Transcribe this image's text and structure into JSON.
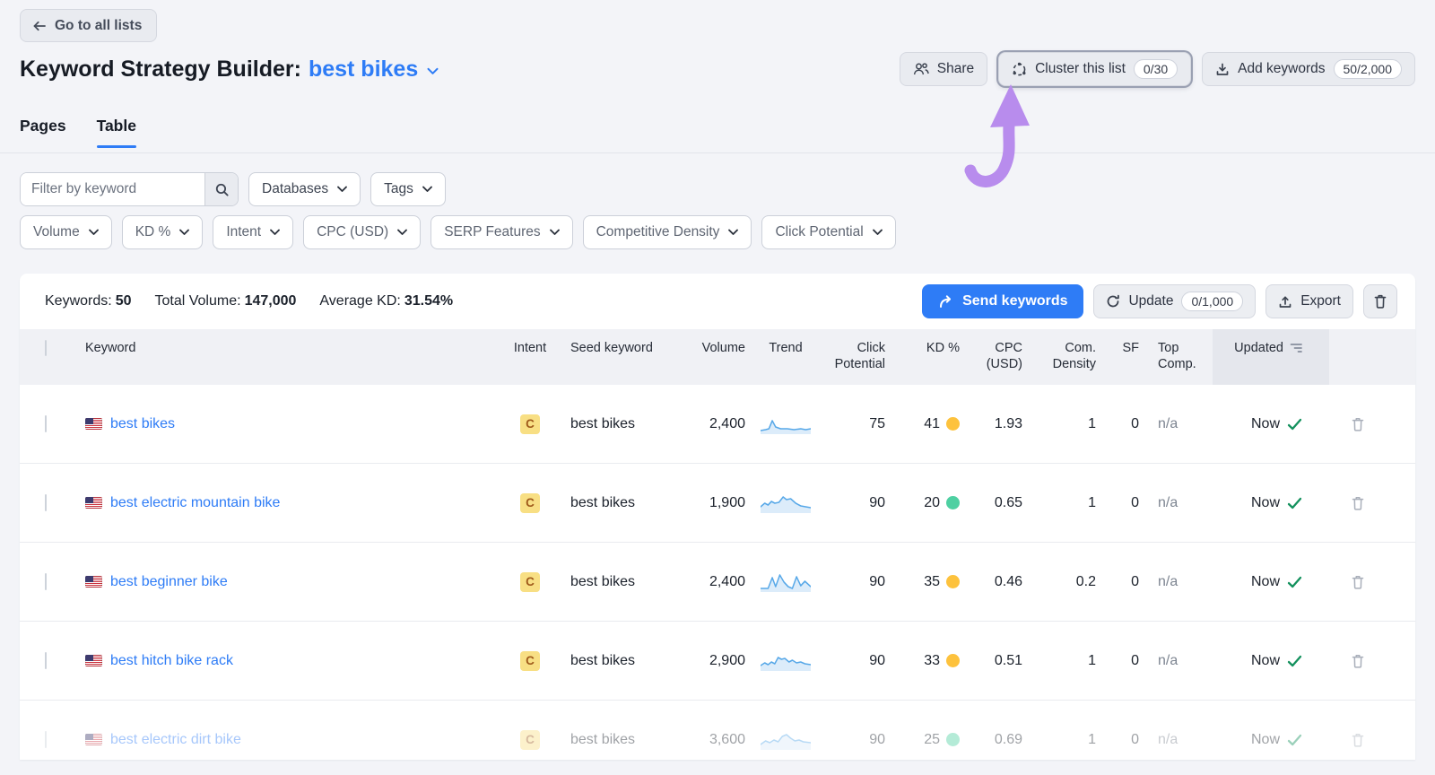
{
  "back_button": {
    "label": "Go to all lists"
  },
  "header": {
    "title": "Keyword Strategy Builder:",
    "list_name": "best bikes",
    "actions": {
      "share_label": "Share",
      "cluster_label": "Cluster this list",
      "cluster_badge": "0/30",
      "add_keywords_label": "Add keywords",
      "add_keywords_badge": "50/2,000"
    }
  },
  "tabs": {
    "pages": "Pages",
    "table": "Table"
  },
  "filters": {
    "keyword_placeholder": "Filter by keyword",
    "databases": "Databases",
    "tags": "Tags",
    "pills": [
      "Volume",
      "KD %",
      "Intent",
      "CPC (USD)",
      "SERP Features",
      "Competitive Density",
      "Click Potential"
    ]
  },
  "toolbar": {
    "keywords_label": "Keywords:",
    "keywords_value": "50",
    "total_volume_label": "Total Volume:",
    "total_volume_value": "147,000",
    "average_kd_label": "Average KD:",
    "average_kd_value": "31.54%",
    "send_label": "Send keywords",
    "update_label": "Update",
    "update_badge": "0/1,000",
    "export_label": "Export"
  },
  "table": {
    "header": {
      "keyword": "Keyword",
      "intent": "Intent",
      "seed": "Seed keyword",
      "volume": "Volume",
      "trend": "Trend",
      "click_potential": "Click Potential",
      "kd": "KD %",
      "cpc": "CPC (USD)",
      "com_density": "Com. Density",
      "sf": "SF",
      "top_comp": "Top Comp.",
      "updated": "Updated"
    },
    "rows": [
      {
        "country": "us",
        "keyword": "best bikes",
        "intent": "C",
        "seed": "best bikes",
        "volume": "2,400",
        "click_potential": "75",
        "kd": "41",
        "kd_level": "orange",
        "cpc": "1.93",
        "com_density": "1",
        "sf": "0",
        "top_comp": "n/a",
        "updated": "Now",
        "trend": [
          [
            0,
            19
          ],
          [
            6,
            18
          ],
          [
            10,
            17
          ],
          [
            14,
            8
          ],
          [
            18,
            15
          ],
          [
            24,
            17
          ],
          [
            32,
            17
          ],
          [
            40,
            18
          ],
          [
            48,
            17
          ],
          [
            54,
            18
          ],
          [
            60,
            17
          ]
        ]
      },
      {
        "country": "us",
        "keyword": "best electric mountain bike",
        "intent": "C",
        "seed": "best bikes",
        "volume": "1,900",
        "click_potential": "90",
        "kd": "20",
        "kd_level": "green",
        "cpc": "0.65",
        "com_density": "1",
        "sf": "0",
        "top_comp": "n/a",
        "updated": "Now",
        "trend": [
          [
            0,
            16
          ],
          [
            5,
            12
          ],
          [
            9,
            14
          ],
          [
            13,
            10
          ],
          [
            17,
            12
          ],
          [
            22,
            11
          ],
          [
            27,
            5
          ],
          [
            31,
            8
          ],
          [
            36,
            7
          ],
          [
            42,
            12
          ],
          [
            48,
            15
          ],
          [
            54,
            16
          ],
          [
            60,
            17
          ]
        ]
      },
      {
        "country": "us",
        "keyword": "best beginner bike",
        "intent": "C",
        "seed": "best bikes",
        "volume": "2,400",
        "click_potential": "90",
        "kd": "35",
        "kd_level": "orange",
        "cpc": "0.46",
        "com_density": "0.2",
        "sf": "0",
        "top_comp": "n/a",
        "updated": "Now",
        "trend": [
          [
            0,
            19
          ],
          [
            9,
            19
          ],
          [
            14,
            7
          ],
          [
            18,
            17
          ],
          [
            23,
            4
          ],
          [
            28,
            12
          ],
          [
            33,
            17
          ],
          [
            38,
            19
          ],
          [
            43,
            6
          ],
          [
            48,
            16
          ],
          [
            53,
            11
          ],
          [
            60,
            17
          ]
        ]
      },
      {
        "country": "us",
        "keyword": "best hitch bike rack",
        "intent": "C",
        "seed": "best bikes",
        "volume": "2,900",
        "click_potential": "90",
        "kd": "33",
        "kd_level": "orange",
        "cpc": "0.51",
        "com_density": "1",
        "sf": "0",
        "top_comp": "n/a",
        "updated": "Now",
        "trend": [
          [
            0,
            17
          ],
          [
            5,
            14
          ],
          [
            9,
            16
          ],
          [
            13,
            13
          ],
          [
            17,
            15
          ],
          [
            21,
            8
          ],
          [
            25,
            10
          ],
          [
            29,
            9
          ],
          [
            34,
            13
          ],
          [
            38,
            11
          ],
          [
            43,
            14
          ],
          [
            48,
            13
          ],
          [
            53,
            15
          ],
          [
            60,
            16
          ]
        ]
      },
      {
        "country": "us",
        "keyword": "best electric dirt bike",
        "intent": "C",
        "seed": "best bikes",
        "volume": "3,600",
        "click_potential": "90",
        "kd": "25",
        "kd_level": "green",
        "cpc": "0.69",
        "com_density": "1",
        "sf": "0",
        "top_comp": "n/a",
        "updated": "Now",
        "faded": true,
        "trend": [
          [
            0,
            17
          ],
          [
            6,
            13
          ],
          [
            11,
            15
          ],
          [
            16,
            12
          ],
          [
            21,
            14
          ],
          [
            26,
            8
          ],
          [
            31,
            6
          ],
          [
            36,
            10
          ],
          [
            41,
            13
          ],
          [
            46,
            12
          ],
          [
            51,
            14
          ],
          [
            60,
            15
          ]
        ]
      }
    ]
  },
  "colors": {
    "accent_blue": "#2e7cf6",
    "kd_levels": {
      "green": "#4ed0a2",
      "orange": "#fdc23d"
    },
    "intent_badge_bg": "#f8df84",
    "intent_badge_text": "#9f5a1b",
    "spark_stroke": "#57a8e8",
    "spark_fill": "#dcecfa",
    "check_green": "#13915d",
    "arrow_purple": "#b88ced"
  }
}
